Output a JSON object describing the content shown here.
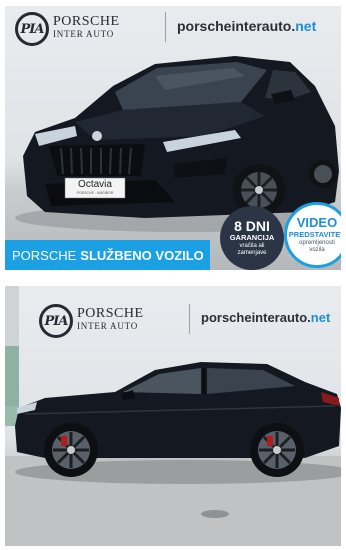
{
  "brand": {
    "monogram": "PIA",
    "name_line1": "PORSCHE",
    "name_line2": "INTER AUTO",
    "site_url_main": "porscheinterauto.",
    "site_url_tld": "net"
  },
  "listing_photo_1": {
    "plate_text": "Octavia",
    "plate_subtext": "PORSCHE · MARIBOR",
    "banner_regular": "PORSCHE",
    "banner_bold": "SLUŽBENO VOZILO",
    "badge_guarantee": {
      "title": "8 DNI",
      "subtitle": "GARANCIJA",
      "note_line1": "vračila ali",
      "note_line2": "zamenjave"
    },
    "badge_video": {
      "title": "VIDEO",
      "subtitle": "PREDSTAVITEV",
      "note_line1": "opremljenosti",
      "note_line2": "vozila"
    }
  },
  "colors": {
    "banner_blue": "#1aa0e3",
    "badge_dark": "#2b3545",
    "car_body": "#141820",
    "accent_tld": "#1d8fd6"
  }
}
